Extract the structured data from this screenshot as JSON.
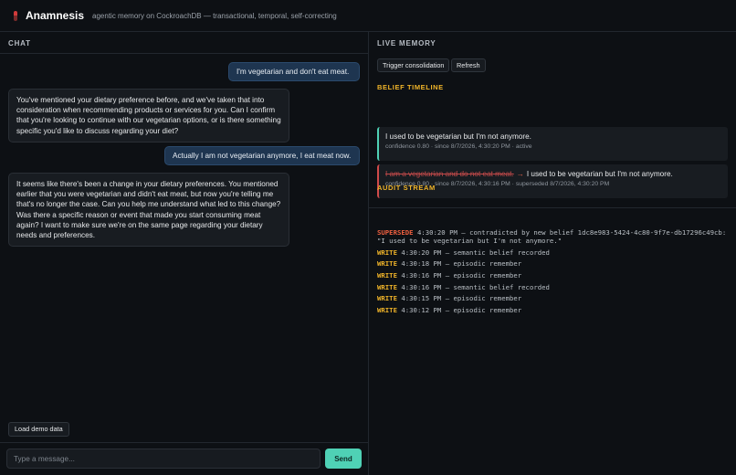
{
  "app": {
    "title": "Anamnesis",
    "subtitle": "agentic memory on CockroachDB — transactional, temporal, self-correcting",
    "logo_icon": "cockroach-logo-icon"
  },
  "chat": {
    "heading": "CHAT",
    "messages": [
      {
        "role": "user",
        "text": "I'm vegetarian and don't eat meat."
      },
      {
        "role": "assistant",
        "text": "You've mentioned your dietary preference before, and we've taken that into consideration when recommending products or services for you. Can I confirm that you're looking to continue with our vegetarian options, or is there something specific you'd like to discuss regarding your diet?"
      },
      {
        "role": "user",
        "text": "Actually I am not vegetarian anymore, I eat meat now."
      },
      {
        "role": "assistant",
        "text": "It seems like there's been a change in your dietary preferences. You mentioned earlier that you were vegetarian and didn't eat meat, but now you're telling me that's no longer the case. Can you help me understand what led to this change? Was there a specific reason or event that made you start consuming meat again? I want to make sure we're on the same page regarding your dietary needs and preferences."
      }
    ],
    "load_demo_label": "Load demo data",
    "input_placeholder": "Type a message...",
    "send_label": "Send"
  },
  "memory": {
    "heading": "LIVE MEMORY",
    "trigger_label": "Trigger consolidation",
    "refresh_label": "Refresh",
    "timeline_heading": "BELIEF TIMELINE",
    "beliefs": [
      {
        "status": "active",
        "text": "I used to be vegetarian but I'm not anymore.",
        "meta": "confidence 0.80 · since 8/7/2026, 4:30:20 PM · active"
      },
      {
        "status": "superseded",
        "old_text": "I am a vegetarian and do not eat meat.",
        "text": "I used to be vegetarian but I'm not anymore.",
        "meta": "confidence 0.80 · since 8/7/2026, 4:30:16 PM · superseded 8/7/2026, 4:30:20 PM"
      }
    ],
    "audit_heading": "AUDIT STREAM",
    "audit": [
      {
        "kind": "SUPERSEDE",
        "text": "4:30:20 PM — contradicted by new belief 1dc8e983-5424-4c80-9f7e-db17296c49cb: \"I used to be vegetarian but I'm not anymore.\""
      },
      {
        "kind": "WRITE",
        "text": "4:30:20 PM — semantic belief recorded"
      },
      {
        "kind": "WRITE",
        "text": "4:30:18 PM — episodic remember"
      },
      {
        "kind": "WRITE",
        "text": "4:30:16 PM — episodic remember"
      },
      {
        "kind": "WRITE",
        "text": "4:30:16 PM — semantic belief recorded"
      },
      {
        "kind": "WRITE",
        "text": "4:30:15 PM — episodic remember"
      },
      {
        "kind": "WRITE",
        "text": "4:30:12 PM — episodic remember"
      }
    ]
  },
  "colors": {
    "accent": "#4fd1b5",
    "warning": "#f0b429",
    "danger": "#f06040",
    "user_bubble": "#1e3550"
  }
}
